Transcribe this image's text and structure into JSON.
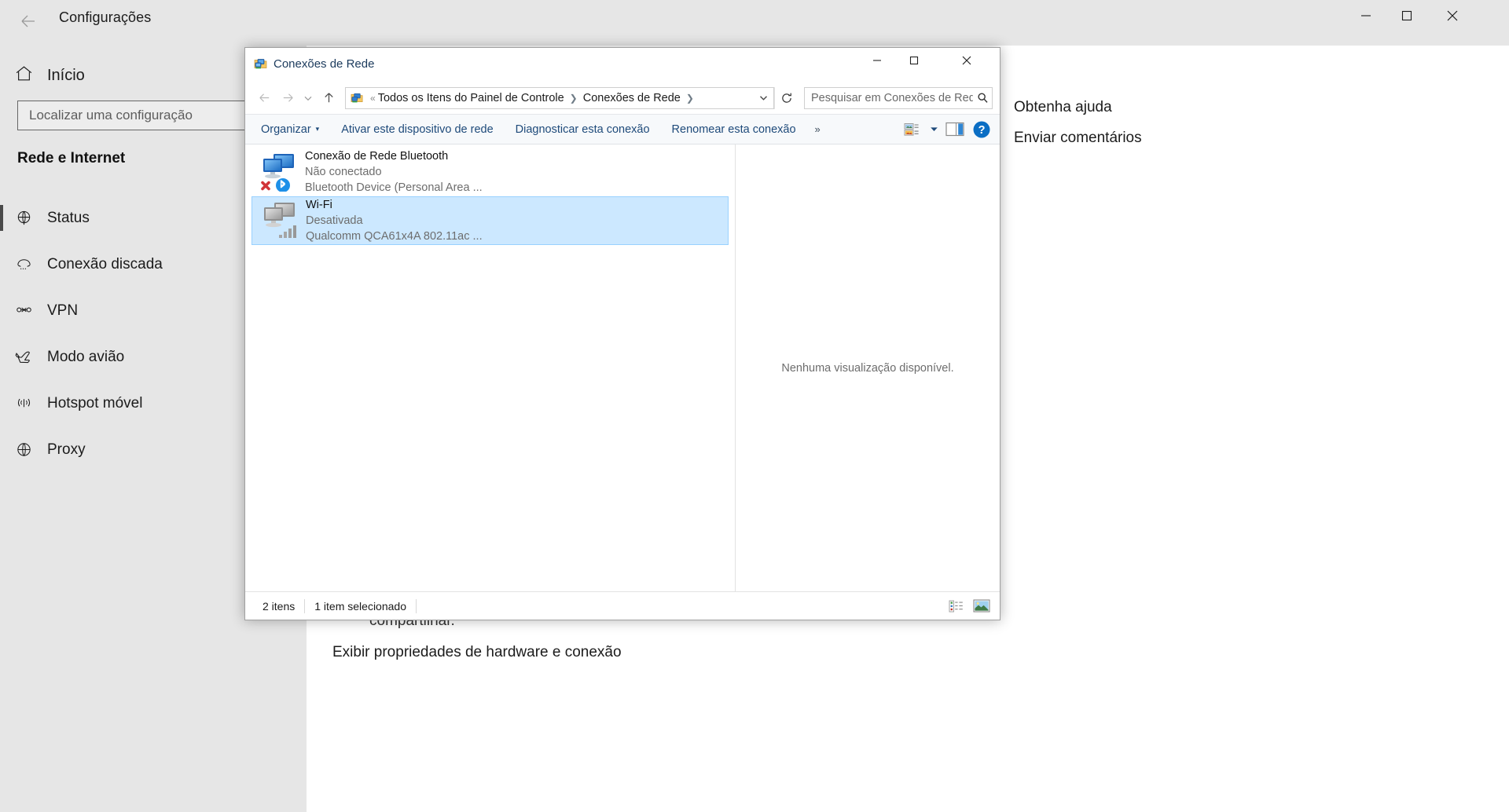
{
  "settings": {
    "title": "Configurações",
    "back_label": "←",
    "window_controls": {
      "minimize": "minimize-icon",
      "maximize": "maximize-icon",
      "close": "close-icon"
    },
    "home": {
      "label": "Início",
      "icon": "home-icon"
    },
    "search": {
      "placeholder": "Localizar uma configuração",
      "value": "",
      "icon": "search-icon"
    },
    "section_heading": "Rede e Internet",
    "nav_items": [
      {
        "label": "Status",
        "icon": "globe-icon",
        "selected": true
      },
      {
        "label": "Conexão discada",
        "icon": "dialup-icon",
        "selected": false
      },
      {
        "label": "VPN",
        "icon": "vpn-icon",
        "selected": false
      },
      {
        "label": "Modo avião",
        "icon": "airplane-icon",
        "selected": false
      },
      {
        "label": "Hotspot móvel",
        "icon": "hotspot-icon",
        "selected": false
      },
      {
        "label": "Proxy",
        "icon": "globe-icon",
        "selected": false
      }
    ],
    "content": {
      "help_link": "Obtenha ajuda",
      "feedback_link": "Enviar comentários",
      "share_text": "compartilhar.",
      "hardware_link": "Exibir propriedades de hardware e conexão"
    }
  },
  "explorer": {
    "title": "Conexões de Rede",
    "title_icon": "network-connections-icon",
    "window_controls": {
      "minimize": "minimize-icon",
      "maximize": "maximize-icon",
      "close": "close-icon"
    },
    "nav": {
      "back": "back-arrow-icon",
      "forward": "forward-arrow-icon",
      "recent": "recent-locations-icon",
      "up": "up-arrow-icon",
      "refresh": "refresh-icon",
      "dropdown": "chevron-down-icon"
    },
    "breadcrumb": {
      "overflow": "«",
      "items": [
        "Todos os Itens do Painel de Controle",
        "Conexões de Rede"
      ],
      "separator": "❯"
    },
    "search": {
      "placeholder": "Pesquisar em Conexões de Rede",
      "value": "",
      "icon": "search-icon"
    },
    "toolbar": {
      "organize": "Organizar",
      "organize_caret": "▾",
      "commands": [
        "Ativar este dispositivo de rede",
        "Diagnosticar esta conexão",
        "Renomear esta conexão"
      ],
      "overflow": "»",
      "view_icon": "change-view-icon",
      "view_caret": "▾",
      "preview_pane_icon": "preview-pane-icon",
      "help_icon": "help-icon"
    },
    "connections": [
      {
        "name": "Conexão de Rede Bluetooth",
        "status": "Não conectado",
        "device": "Bluetooth Device (Personal Area ...",
        "icon": "network-adapter-bluetooth-icon",
        "overlay": "red-x-icon",
        "selected": false
      },
      {
        "name": "Wi-Fi",
        "status": "Desativada",
        "device": "Qualcomm QCA61x4A 802.11ac ...",
        "icon": "network-adapter-wifi-disabled-icon",
        "overlay": "signal-bars-icon",
        "selected": true
      }
    ],
    "preview": {
      "empty_text": "Nenhuma visualização disponível."
    },
    "status_bar": {
      "item_count": "2 itens",
      "selection": "1 item selecionado",
      "details_view_icon": "details-view-icon",
      "large_icons_view_icon": "large-icons-view-icon"
    }
  },
  "colors": {
    "settings_chrome": "#e6e6e6",
    "selection_blue": "#cce8ff",
    "selection_border": "#99d1ff",
    "toolbar_link": "#1e4a7a",
    "help_blue": "#0b6ec4",
    "bluetooth_blue": "#1e90e8",
    "red_x": "#d13438"
  }
}
